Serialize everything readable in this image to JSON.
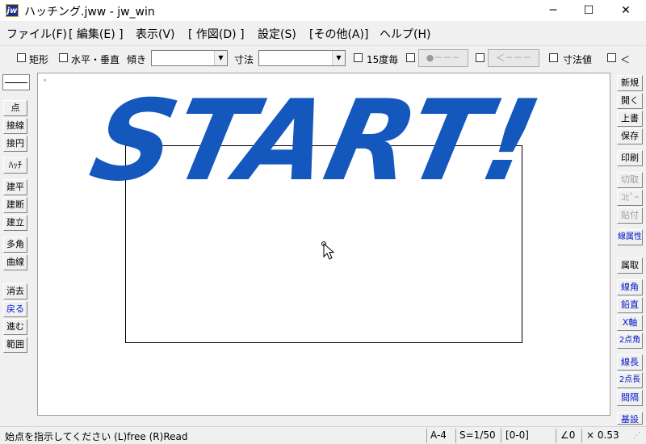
{
  "window": {
    "title": "ハッチング.jww - jw_win",
    "app_icon_label": "jw",
    "minimize_glyph": "─",
    "maximize_glyph": "☐",
    "close_glyph": "✕"
  },
  "menu": [
    "ファイル(F)",
    "[ 編集(E) ]",
    "表示(V)",
    "[ 作図(D) ]",
    "設定(S)",
    "[その他(A)]",
    "ヘルプ(H)"
  ],
  "toolbar": {
    "rect_label": "矩形",
    "hv_label": "水平・垂直",
    "tilt_label": "傾き",
    "tilt_value": "",
    "dim_label": "寸法",
    "dim_value": "",
    "deg15_label": "15度毎",
    "point_button": "●－－－",
    "arrow_button": "＜－－－",
    "dimval_label": "寸法値",
    "last_label": "＜"
  },
  "left_buttons": [
    "点",
    "接線",
    "接円",
    "ﾊｯﾁ",
    "建平",
    "建断",
    "建立",
    "多角形",
    "曲線",
    "消去",
    "戻る",
    "進む",
    "範囲"
  ],
  "right_buttons": [
    "新規",
    "開く",
    "上書",
    "保存",
    "印刷",
    "切取",
    "ｺﾋﾟｰ",
    "貼付",
    "線属性",
    "属取",
    "線角",
    "鉛直",
    "X軸",
    "2点角",
    "線長",
    "2点長",
    "間隔",
    "基設"
  ],
  "canvas": {
    "banner_text": "START!",
    "banner_color": "#1457bd"
  },
  "status": {
    "message": "始点を指示してください (L)free (R)Read",
    "paper": "A-4",
    "scale": "S=1/50",
    "layer": "[0-0]",
    "angle": "∠0",
    "zoom": "× 0.53"
  }
}
